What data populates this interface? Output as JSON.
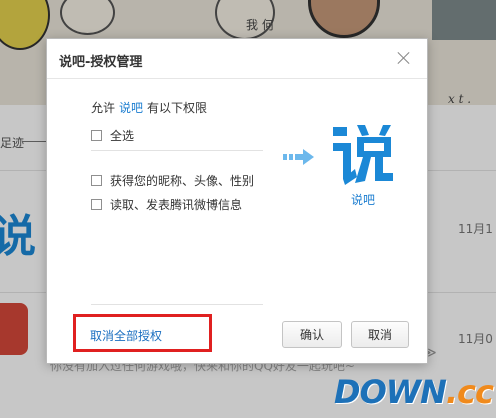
{
  "background": {
    "doodle_text": "我 何",
    "doodle_sign": "x t .",
    "footprint_label": "足迹",
    "dates": [
      "11月1",
      "11月0"
    ],
    "snippet": "你没有加入过任何游戏哦，快来和你的QQ好友一起玩吧~",
    "snippet_mark": "≫"
  },
  "dialog": {
    "title": "说吧-授权管理",
    "close_icon": "close-icon",
    "allow_prefix": "允许",
    "allow_app": "说吧",
    "allow_suffix": "有以下权限",
    "permissions": [
      {
        "label": "全选",
        "checked": false
      },
      {
        "label": "获得您的昵称、头像、性别",
        "checked": false
      },
      {
        "label": "读取、发表腾讯微博信息",
        "checked": false
      }
    ],
    "app_logo_icon": "shuoba-logo-icon",
    "app_name": "说吧",
    "revoke_all": "取消全部授权",
    "confirm_label": "确认",
    "cancel_label": "取消"
  },
  "watermark": {
    "main": "DOWN",
    "accent": ".cc"
  },
  "colors": {
    "link_blue": "#1b7dd0",
    "highlight_red": "#e02020",
    "arrow_blue": "#6cb8ec",
    "logo_blue": "#1b88d6"
  }
}
